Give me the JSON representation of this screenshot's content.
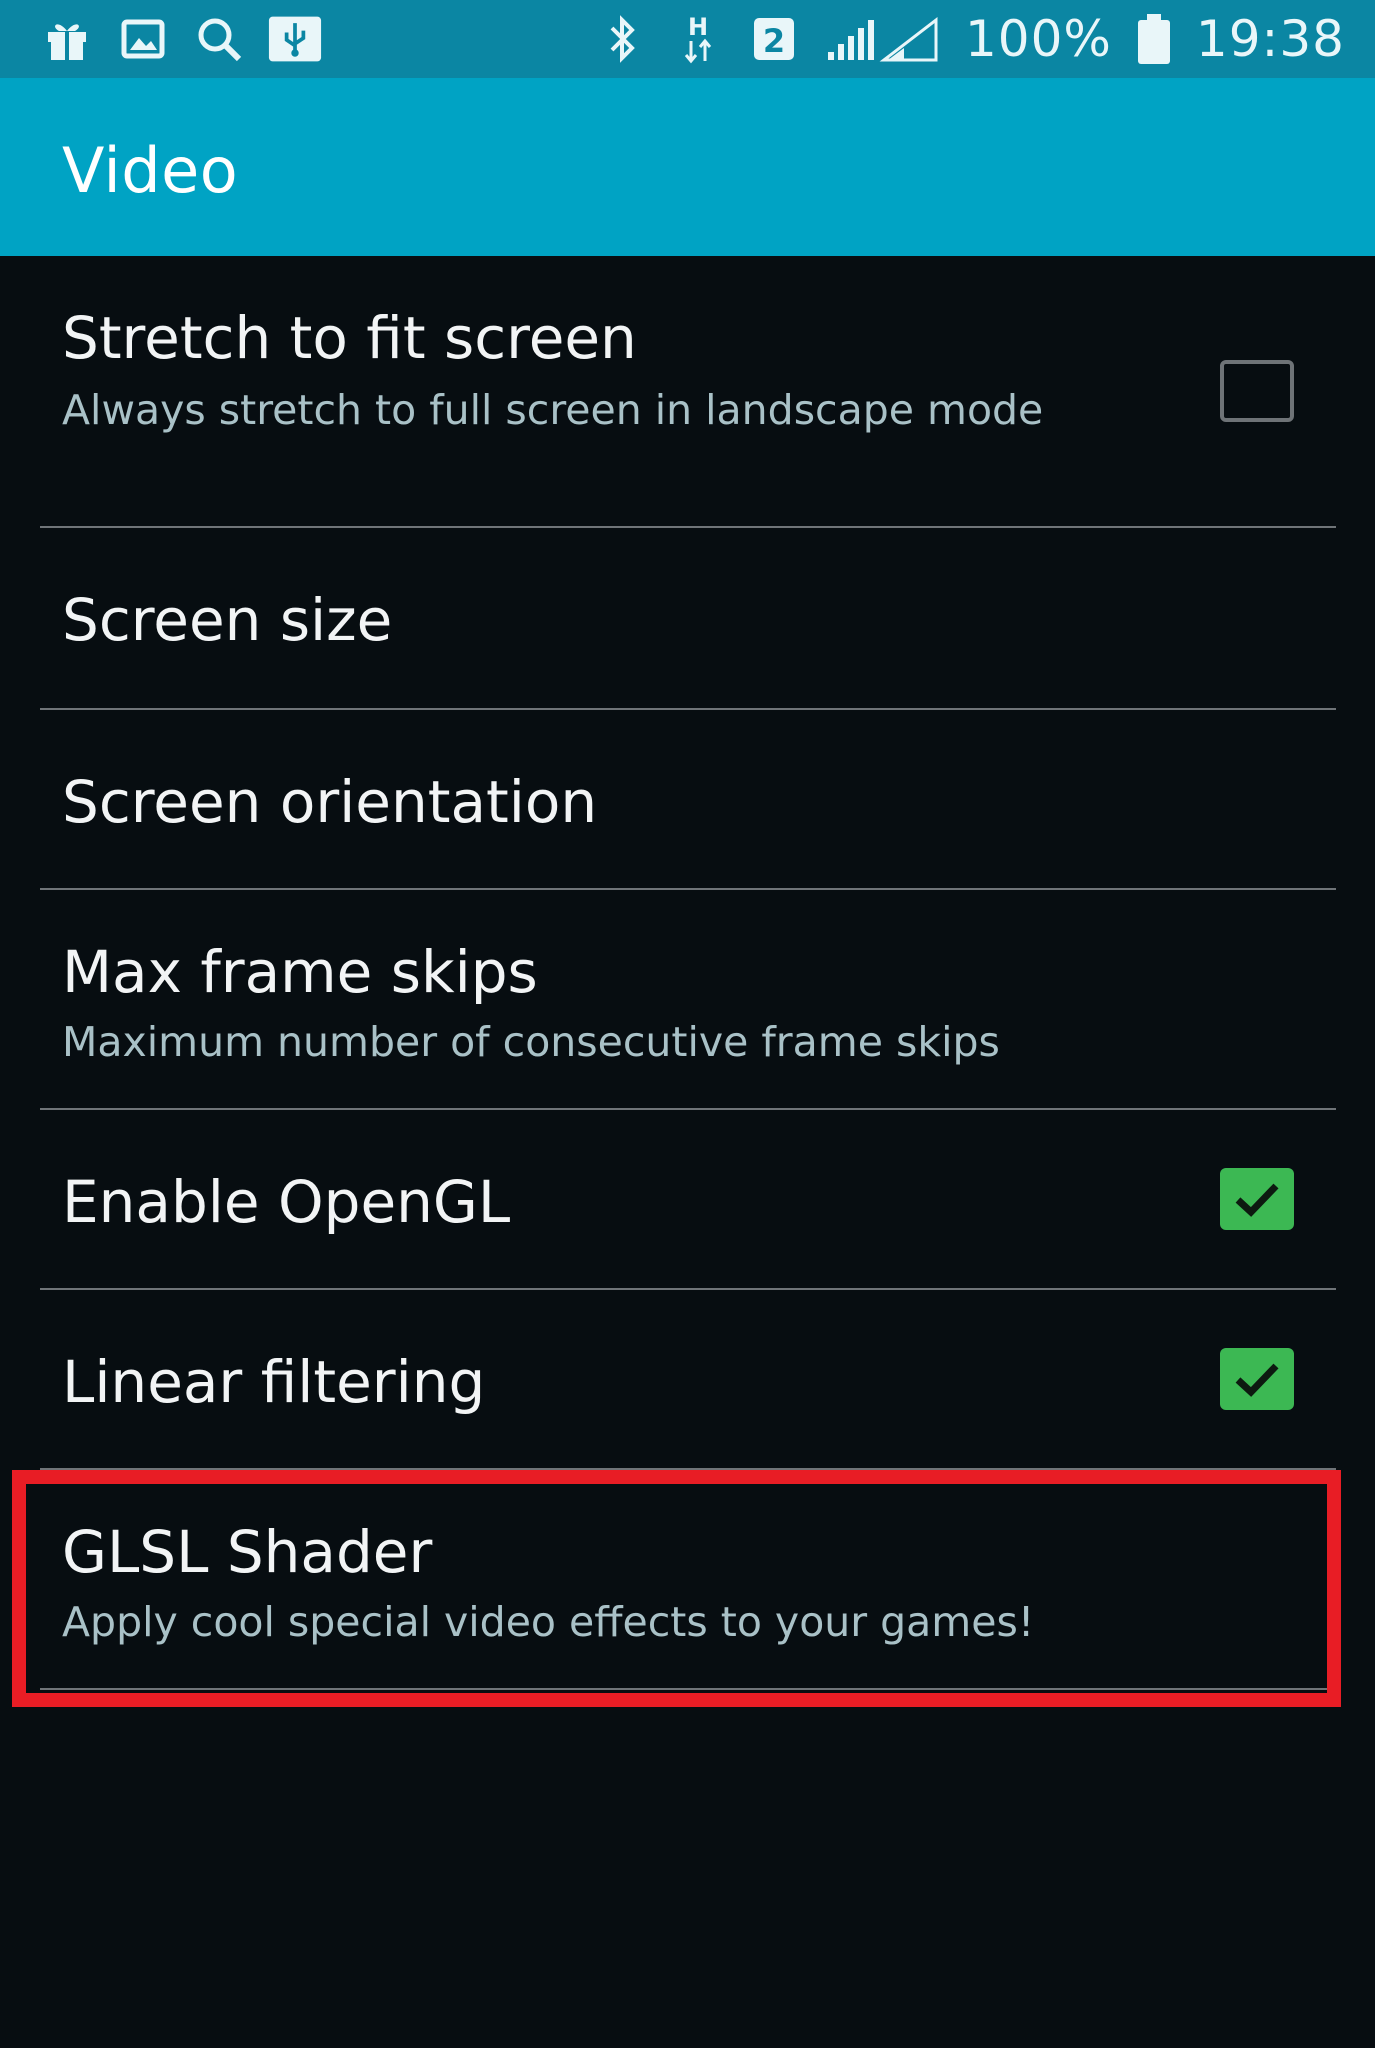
{
  "status_bar": {
    "left_icons": [
      "gift-icon",
      "image-icon",
      "search-icon",
      "usb-icon"
    ],
    "right_icons": [
      "bluetooth-icon",
      "data-h-icon",
      "sim2-icon",
      "signal-icon"
    ],
    "battery": "100%",
    "time": "19:38"
  },
  "header": {
    "title": "Video"
  },
  "settings": [
    {
      "title": "Stretch to fit screen",
      "subtitle": "Always stretch to full screen in landscape mode",
      "checkbox": false
    },
    {
      "title": "Screen size"
    },
    {
      "title": "Screen orientation"
    },
    {
      "title": "Max frame skips",
      "subtitle": "Maximum number of consecutive frame skips"
    },
    {
      "title": "Enable OpenGL",
      "checkbox": true
    },
    {
      "title": "Linear filtering",
      "checkbox": true
    },
    {
      "title": "GLSL Shader",
      "subtitle": "Apply cool special video effects to your games!",
      "highlighted": true
    }
  ],
  "colors": {
    "status_bar": "#0b86a3",
    "header": "#00a3c4",
    "background": "#070d11",
    "checkbox_on": "#3cb853",
    "highlight": "#e81d25"
  }
}
